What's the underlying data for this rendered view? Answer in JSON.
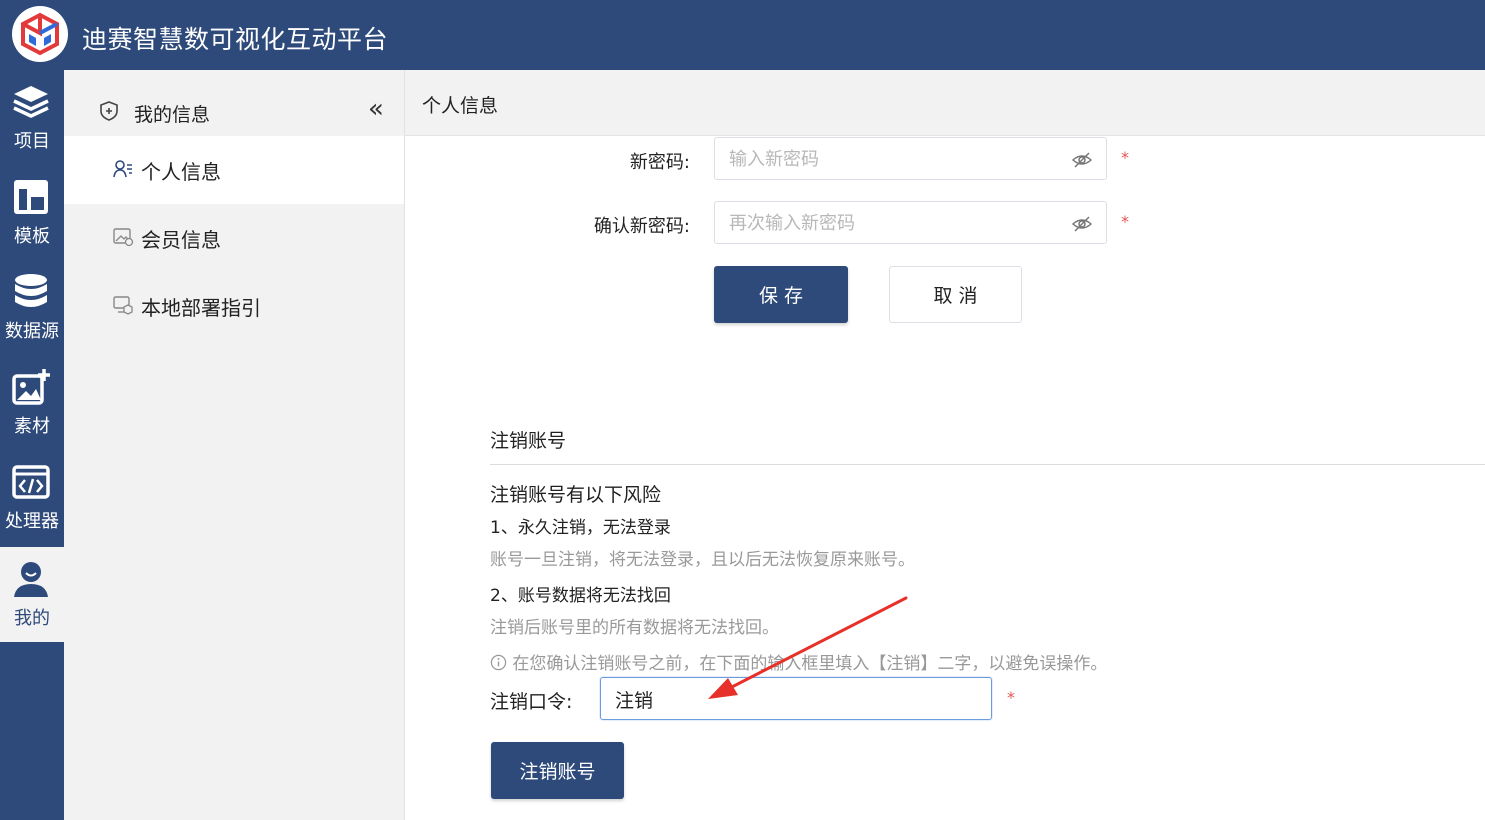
{
  "app": {
    "title": "迪赛智慧数可视化互动平台",
    "brand_color": "#2e4a7a"
  },
  "rail": {
    "items": [
      {
        "label": "项目",
        "icon": "layers-icon"
      },
      {
        "label": "模板",
        "icon": "template-icon"
      },
      {
        "label": "数据源",
        "icon": "database-icon"
      },
      {
        "label": "素材",
        "icon": "add-image-icon"
      },
      {
        "label": "处理器",
        "icon": "code-icon"
      },
      {
        "label": "我的",
        "icon": "user-icon",
        "active": true
      }
    ]
  },
  "subnav": {
    "header": "我的信息",
    "collapse_glyph": "«",
    "items": [
      {
        "label": "个人信息",
        "icon": "user-card-icon",
        "active": true
      },
      {
        "label": "会员信息",
        "icon": "member-image-icon"
      },
      {
        "label": "本地部署指引",
        "icon": "deploy-icon"
      }
    ]
  },
  "main": {
    "title": "个人信息",
    "password_form": {
      "new_label": "新密码:",
      "new_placeholder": "输入新密码",
      "confirm_label": "确认新密码:",
      "confirm_placeholder": "再次输入新密码",
      "required_mark": "*",
      "save_label": "保 存",
      "cancel_label": "取 消"
    },
    "deregister": {
      "section_title": "注销账号",
      "risk_heading": "注销账号有以下风险",
      "risk1_title": "1、永久注销，无法登录",
      "risk1_desc": "账号一旦注销，将无法登录，且以后无法恢复原来账号。",
      "risk2_title": "2、账号数据将无法找回",
      "risk2_desc": "注销后账号里的所有数据将无法找回。",
      "notice": "在您确认注销账号之前，在下面的输入框里填入【注销】二字，以避免误操作。",
      "passphrase_label": "注销口令:",
      "passphrase_value": "注销",
      "required_mark": "*",
      "submit_label": "注销账号"
    }
  },
  "colors": {
    "required": "#e25555",
    "annotation_arrow": "#e8302a"
  }
}
